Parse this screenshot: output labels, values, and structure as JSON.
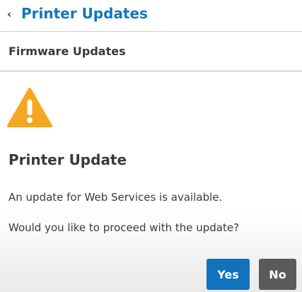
{
  "header": {
    "back_icon": "chevron-left-icon",
    "title": "Printer Updates"
  },
  "section": {
    "title": "Firmware Updates"
  },
  "dialog": {
    "icon": "warning-icon",
    "icon_color": "#f5a623",
    "title": "Printer Update",
    "message": "An update for Web Services is available.",
    "question": "Would you like to proceed with the update?"
  },
  "buttons": {
    "yes_label": "Yes",
    "no_label": "No",
    "yes_color": "#1172be",
    "no_color": "#5a5a5a"
  },
  "colors": {
    "accent": "#0f77bf",
    "text": "#3a3a3a"
  }
}
